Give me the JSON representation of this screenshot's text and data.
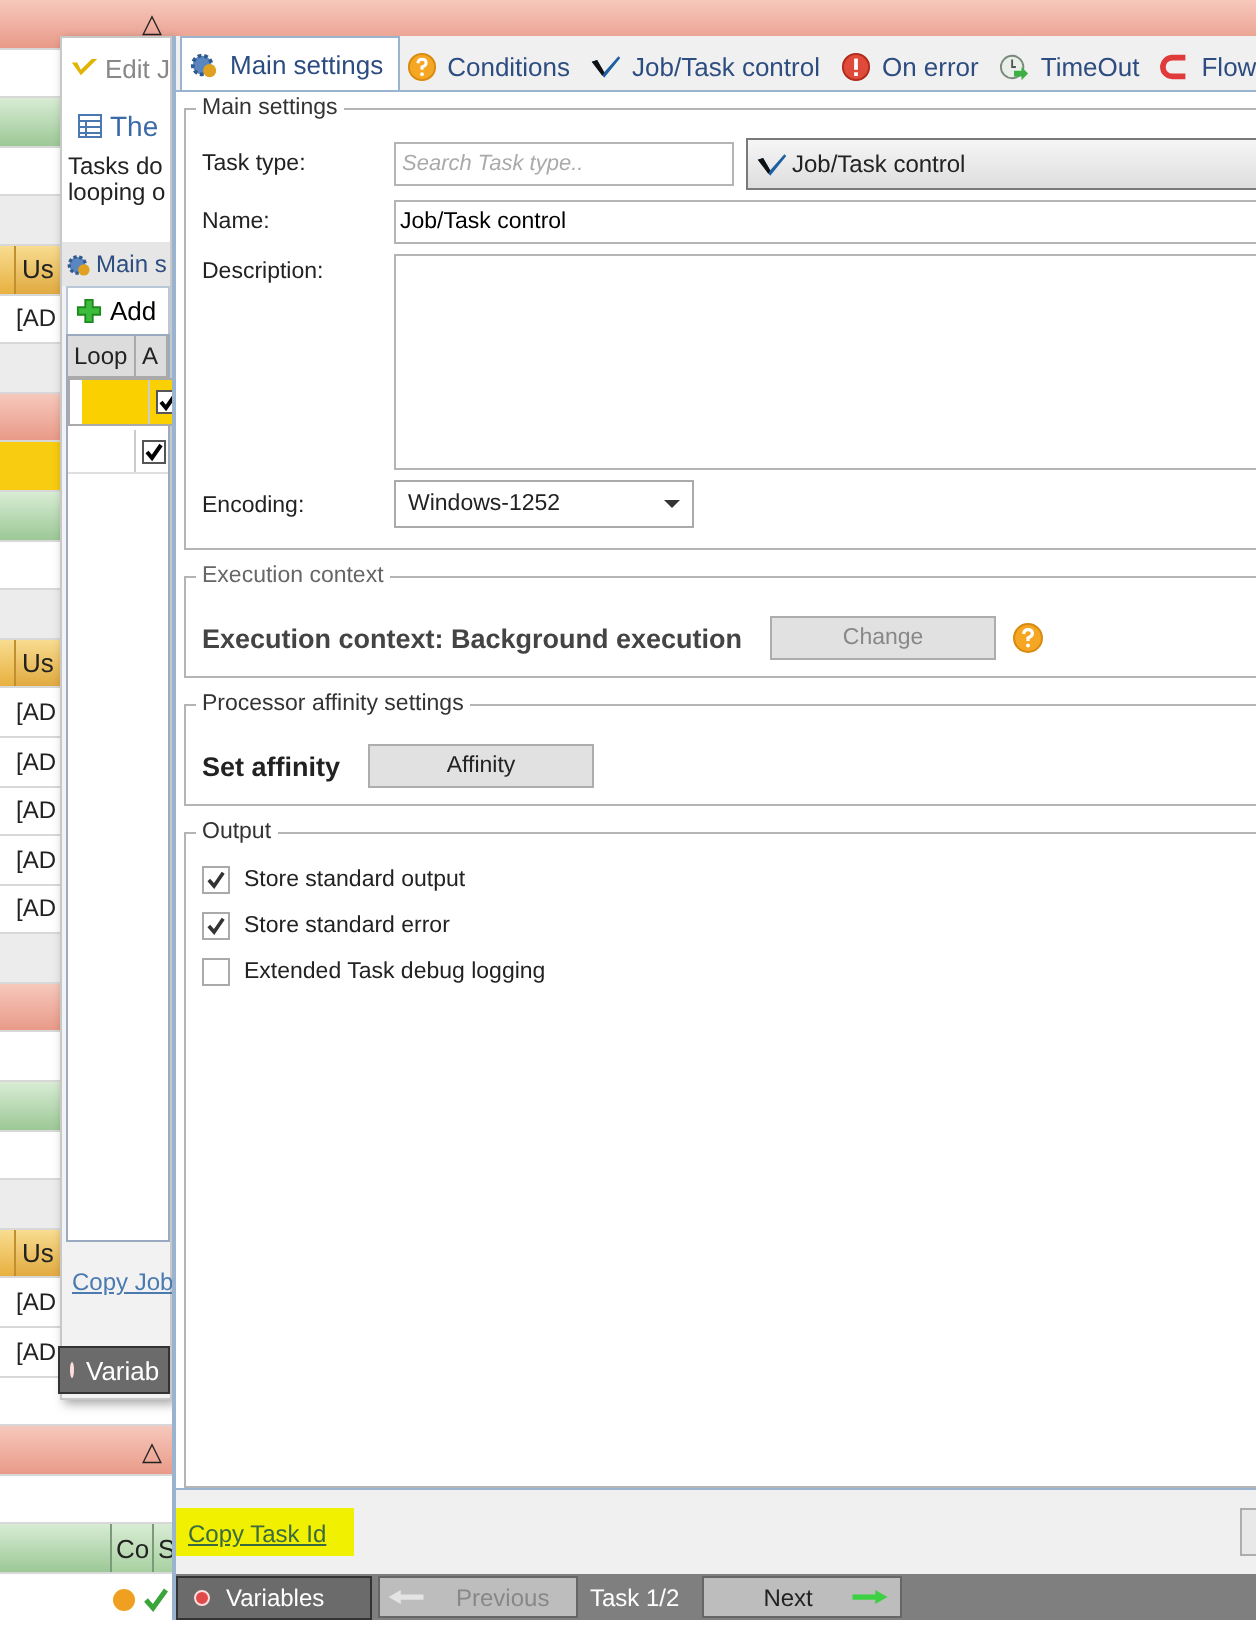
{
  "background": {
    "rows": [
      {
        "kind": "red-group",
        "label": "△"
      },
      {
        "kind": "blank"
      },
      {
        "kind": "green-group"
      },
      {
        "kind": "blank"
      },
      {
        "kind": "grey"
      },
      {
        "kind": "columns",
        "cells": [
          "Us"
        ]
      },
      {
        "kind": "row",
        "cells": [
          "[AD"
        ]
      },
      {
        "kind": "grey"
      },
      {
        "kind": "red-group"
      },
      {
        "kind": "yellow"
      },
      {
        "kind": "green-group"
      },
      {
        "kind": "blank"
      },
      {
        "kind": "grey"
      },
      {
        "kind": "columns",
        "cells": [
          "Us"
        ]
      },
      {
        "kind": "row",
        "cells": [
          "[AD"
        ]
      },
      {
        "kind": "row",
        "cells": [
          "[AD"
        ]
      },
      {
        "kind": "row",
        "cells": [
          "[AD"
        ]
      },
      {
        "kind": "row",
        "cells": [
          "[AD"
        ]
      },
      {
        "kind": "row",
        "cells": [
          "[AD"
        ]
      },
      {
        "kind": "grey"
      },
      {
        "kind": "red-group"
      },
      {
        "kind": "blank"
      },
      {
        "kind": "green-group"
      },
      {
        "kind": "blank"
      },
      {
        "kind": "grey"
      },
      {
        "kind": "columns",
        "cells": [
          "Us"
        ]
      },
      {
        "kind": "row",
        "cells": [
          "[AD"
        ]
      },
      {
        "kind": "row",
        "cells": [
          "[AD"
        ]
      },
      {
        "kind": "blank"
      },
      {
        "kind": "red-group",
        "label": "△"
      },
      {
        "kind": "blank"
      },
      {
        "kind": "green-columns",
        "cells": [
          "Co",
          "S"
        ]
      },
      {
        "kind": "status"
      }
    ]
  },
  "job_window": {
    "title": "Edit J",
    "heading": "The",
    "description": "Tasks do\nlooping o",
    "tab": "Main s",
    "add": "Add",
    "columns": [
      "Loop",
      "A"
    ],
    "rows": [
      {
        "selected": true,
        "checked": true
      },
      {
        "selected": false,
        "checked": true
      }
    ],
    "link": "Copy Job",
    "variables": "Variab"
  },
  "task_window": {
    "tabs": [
      {
        "kind": "gear",
        "label": "Main settings",
        "selected": true
      },
      {
        "kind": "help",
        "label": "Conditions",
        "selected": false
      },
      {
        "kind": "job",
        "label": "Job/Task control",
        "selected": false
      },
      {
        "kind": "error",
        "label": "On error",
        "selected": false
      },
      {
        "kind": "timeout",
        "label": "TimeOut",
        "selected": false
      },
      {
        "kind": "flow",
        "label": "Flow",
        "selected": false
      }
    ],
    "main_settings": {
      "legend": "Main settings",
      "task_type": {
        "label": "Task type:",
        "placeholder": "Search Task type..",
        "value": "Job/Task control"
      },
      "name": {
        "label": "Name:",
        "value": "Job/Task control"
      },
      "description": {
        "label": "Description:"
      },
      "encoding": {
        "label": "Encoding:",
        "value": "Windows-1252"
      }
    },
    "execution": {
      "legend": "Execution context",
      "text": "Execution context: Background execution",
      "button": {
        "label": "Change",
        "disabled": true
      }
    },
    "affinity": {
      "legend": "Processor affinity settings",
      "text": "Set affinity",
      "button": {
        "label": "Affinity",
        "disabled": false
      }
    },
    "output": {
      "legend": "Output",
      "options": [
        {
          "label": "Store standard output",
          "checked": true
        },
        {
          "label": "Store standard error",
          "checked": true
        },
        {
          "label": "Extended Task debug logging",
          "checked": false
        }
      ]
    },
    "footer": {
      "link": "Copy Task Id",
      "highlighted": true
    },
    "nav": {
      "variables": "Variables",
      "previous": {
        "label": "Previous",
        "disabled": true
      },
      "position": "Task 1/2",
      "next": {
        "label": "Next",
        "disabled": false
      }
    }
  }
}
